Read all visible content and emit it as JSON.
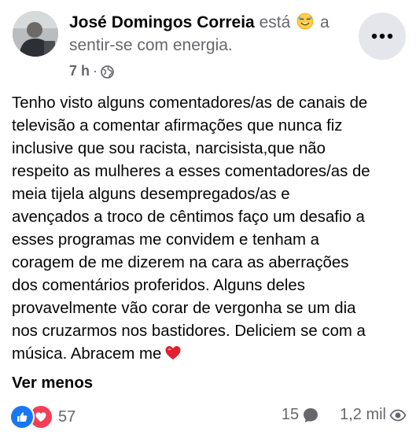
{
  "post": {
    "author": "José Domingos Correia",
    "activity_prefix": "está",
    "activity_emoji": "relieved-face-icon",
    "activity_suffix": "a sentir-se com energia.",
    "time": "7 h",
    "time_separator": "·",
    "privacy_icon": "globe-icon",
    "body_lines": [
      "Tenho visto alguns comentadores/as de canais de",
      "televisão a comentar afirmações que nunca fiz",
      "inclusive que sou racista, narcisista,que não",
      "respeito as mulheres a esses comentadores/as de",
      "meia tijela alguns desempregados/as e",
      "avençados a troco de cêntimos faço um desafio a",
      "esses programas me convidem e tenham a",
      "coragem de me dizerem na cara as aberrações",
      "dos comentários proferidos. Alguns deles",
      "provavelmente vão corar de vergonha se um dia",
      "nos cruzarmos nos bastidores. Deliciem se com a",
      "música. Abracem me"
    ],
    "body_end_emoji": "red-heart-icon",
    "see_less": "Ver menos"
  },
  "footer": {
    "reactions_count": "57",
    "reaction_icons": [
      "like-icon",
      "love-icon"
    ],
    "comments_count": "15",
    "views_count": "1,2 mil"
  },
  "colors": {
    "text": "#050505",
    "secondary": "#65676b",
    "like_blue": "#1877f2",
    "love_red": "#f33e58",
    "button_bg": "#e4e6eb"
  }
}
